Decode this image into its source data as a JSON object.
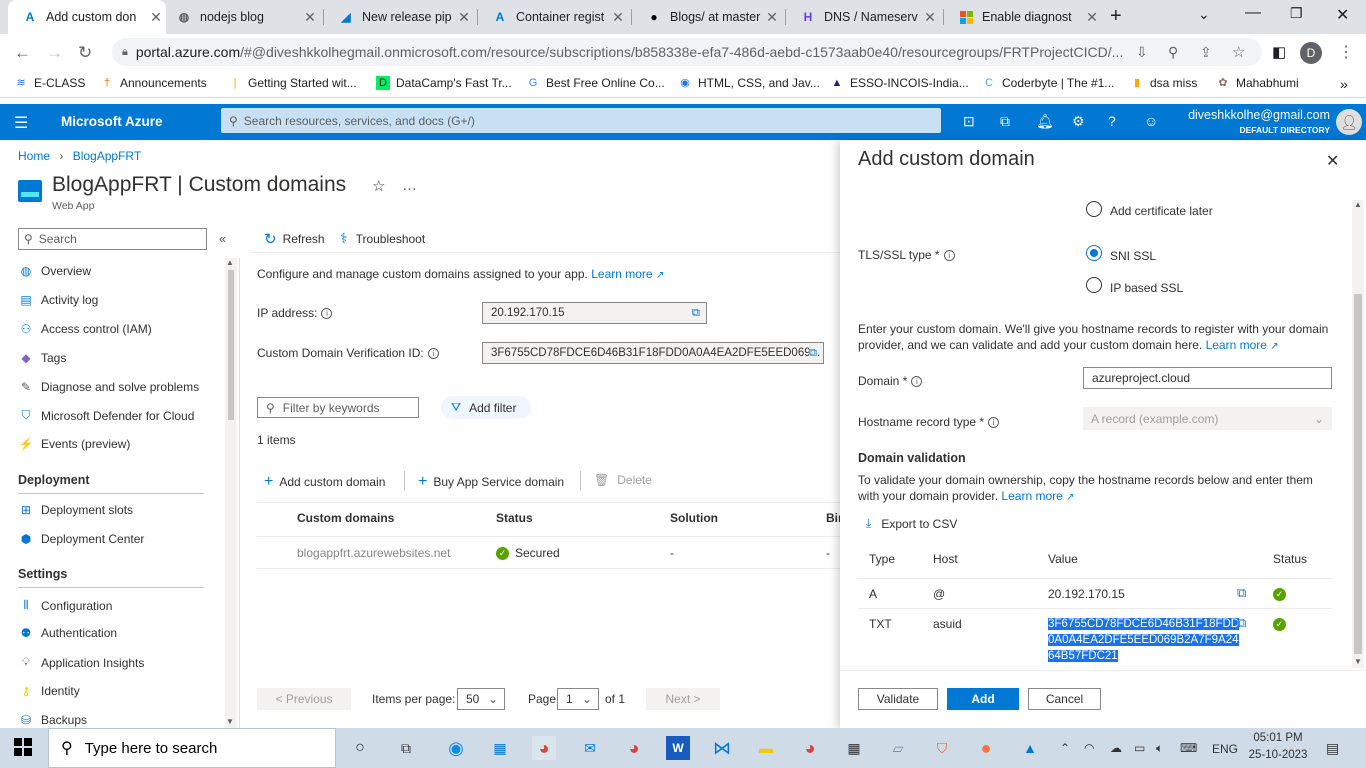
{
  "browser": {
    "tabs": [
      {
        "title": "Add custom don",
        "icon": "azure-icon",
        "active": true
      },
      {
        "title": "nodejs blog",
        "icon": "globe-icon"
      },
      {
        "title": "New release pip",
        "icon": "devops-icon"
      },
      {
        "title": "Container regist",
        "icon": "azure-icon"
      },
      {
        "title": "Blogs/ at master",
        "icon": "github-icon"
      },
      {
        "title": "DNS / Nameserv",
        "icon": "hostinger-icon"
      },
      {
        "title": "Enable diagnost",
        "icon": "microsoft-icon"
      }
    ],
    "new_tab": "+",
    "url_host": "portal.azure.com",
    "url_rest": "/#@diveshkkolhegmail.onmicrosoft.com/resource/subscriptions/b858338e-efa7-486d-aebd-c1573aab0e40/resourcegroups/FRTProjectCICD/...",
    "profile_initial": "D",
    "bookmarks": [
      {
        "label": "E-CLASS"
      },
      {
        "label": "Announcements"
      },
      {
        "label": "Getting Started wit..."
      },
      {
        "label": "DataCamp's Fast Tr..."
      },
      {
        "label": "Best Free Online Co..."
      },
      {
        "label": "HTML, CSS, and Jav..."
      },
      {
        "label": "ESSO-INCOIS-India..."
      },
      {
        "label": "Coderbyte | The #1..."
      },
      {
        "label": "dsa miss"
      },
      {
        "label": "Mahabhumi"
      }
    ]
  },
  "azure": {
    "brand": "Microsoft Azure",
    "search_placeholder": "Search resources, services, and docs (G+/)",
    "user_email": "diveshkkolhe@gmail.com",
    "user_dir": "DEFAULT DIRECTORY"
  },
  "blade": {
    "breadcrumb_home": "Home",
    "breadcrumb_app": "BlogAppFRT",
    "title": "BlogAppFRT | Custom domains",
    "subtitle": "Web App",
    "search_placeholder": "Search",
    "menu": [
      {
        "label": "Overview",
        "icon": "globe-icon"
      },
      {
        "label": "Activity log",
        "icon": "log-icon"
      },
      {
        "label": "Access control (IAM)",
        "icon": "people-icon"
      },
      {
        "label": "Tags",
        "icon": "tag-icon"
      },
      {
        "label": "Diagnose and solve problems",
        "icon": "wrench-icon"
      },
      {
        "label": "Microsoft Defender for Cloud",
        "icon": "shield-icon"
      },
      {
        "label": "Events (preview)",
        "icon": "bolt-icon"
      }
    ],
    "section_deployment": "Deployment",
    "menu_deployment": [
      {
        "label": "Deployment slots"
      },
      {
        "label": "Deployment Center"
      }
    ],
    "section_settings": "Settings",
    "menu_settings": [
      {
        "label": "Configuration"
      },
      {
        "label": "Authentication"
      },
      {
        "label": "Application Insights"
      },
      {
        "label": "Identity"
      },
      {
        "label": "Backups"
      }
    ],
    "toolbar_refresh": "Refresh",
    "toolbar_troubleshoot": "Troubleshoot",
    "description": "Configure and manage custom domains assigned to your app.",
    "learn_more": "Learn more",
    "ip_label": "IP address:",
    "ip_value": "20.192.170.15",
    "verification_label": "Custom Domain Verification ID:",
    "verification_value": "3F6755CD78FDCE6D46B31F18FDD0A0A4EA2DFE5EED069...",
    "filter_placeholder": "Filter by keywords",
    "add_filter": "Add filter",
    "items_count": "1 items",
    "cmd_add": "Add custom domain",
    "cmd_buy": "Buy App Service domain",
    "cmd_delete": "Delete",
    "table_headers": [
      "Custom domains",
      "Status",
      "Solution",
      "Bin"
    ],
    "table_rows": [
      {
        "domain": "blogappfrt.azurewebsites.net",
        "status": "Secured",
        "solution": "-",
        "binding": "-"
      }
    ],
    "pager_prev": "< Previous",
    "pager_items_label": "Items per page:",
    "pager_items_value": "50",
    "pager_page_label": "Page",
    "pager_page_value": "1",
    "pager_of": "of 1",
    "pager_next": "Next >"
  },
  "panel": {
    "title": "Add custom domain",
    "cert_later": "Add certificate later",
    "tls_label": "TLS/SSL type *",
    "tls_sni": "SNI SSL",
    "tls_ip": "IP based SSL",
    "instructions": "Enter your custom domain. We'll give you hostname records to register with your domain provider, and we can validate and add your custom domain here.",
    "learn_more": "Learn more",
    "domain_label": "Domain *",
    "domain_value": "azureproject.cloud",
    "record_type_label": "Hostname record type *",
    "record_type_value": "A record (example.com)",
    "validation_heading": "Domain validation",
    "validation_text": "To validate your domain ownership, copy the hostname records below and enter them with your domain provider.",
    "export_csv": "Export to CSV",
    "headers": [
      "Type",
      "Host",
      "Value",
      "Status"
    ],
    "records": [
      {
        "type": "A",
        "host": "@",
        "value": "20.192.170.15"
      },
      {
        "type": "TXT",
        "host": "asuid",
        "value_lines": [
          "3F6755CD78FDCE6D46B31F18FDD",
          "0A0A4EA2DFE5EED069B2A7F9A24",
          "64B57FDC21"
        ]
      }
    ],
    "btn_validate": "Validate",
    "btn_add": "Add",
    "btn_cancel": "Cancel"
  },
  "taskbar": {
    "search_placeholder": "Type here to search",
    "lang": "ENG",
    "time": "05:01 PM",
    "date": "25-10-2023"
  },
  "colors": {
    "azure_blue": "#0078d4",
    "success": "#57a300"
  }
}
